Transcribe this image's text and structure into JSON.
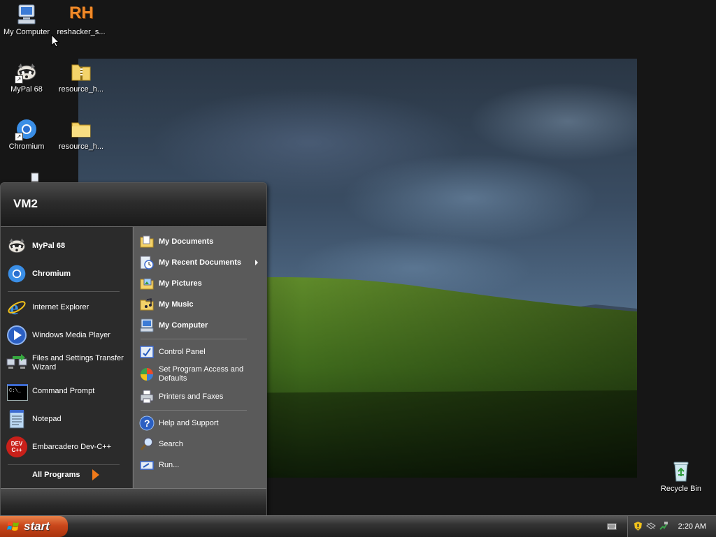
{
  "desktop": {
    "icons": [
      {
        "label": "My Computer"
      },
      {
        "label": "reshacker_s..."
      },
      {
        "label": "MyPal 68"
      },
      {
        "label": "resource_h..."
      },
      {
        "label": "Chromium"
      },
      {
        "label": "resource_h..."
      },
      {
        "label": "Recycle Bin"
      }
    ],
    "reshacker_glyph": "RH"
  },
  "start_menu": {
    "user_name": "VM2",
    "pinned": [
      {
        "label": "MyPal 68"
      },
      {
        "label": "Chromium"
      }
    ],
    "recent": [
      {
        "label": "Internet Explorer"
      },
      {
        "label": "Windows Media Player"
      },
      {
        "label": "Files and Settings Transfer Wizard"
      },
      {
        "label": "Command Prompt"
      },
      {
        "label": "Notepad"
      },
      {
        "label": "Embarcadero Dev-C++"
      }
    ],
    "all_programs_label": "All Programs",
    "places": [
      {
        "label": "My Documents"
      },
      {
        "label": "My Recent Documents"
      },
      {
        "label": "My Pictures"
      },
      {
        "label": "My Music"
      },
      {
        "label": "My Computer"
      }
    ],
    "settings": [
      {
        "label": "Control Panel"
      },
      {
        "label": "Set Program Access and Defaults"
      },
      {
        "label": "Printers and Faxes"
      }
    ],
    "support": [
      {
        "label": "Help and Support"
      },
      {
        "label": "Search"
      },
      {
        "label": "Run..."
      }
    ],
    "cmd_glyph": "C:\\_",
    "devcpp_glyph": "DEV C++"
  },
  "taskbar": {
    "start_label": "start",
    "clock": "2:20 AM"
  },
  "colors": {
    "start_button": "#c9471b",
    "all_programs_arrow": "#f07a1a",
    "menu_left_bg": "#2b2b2b",
    "menu_right_bg": "#5a5a5a"
  }
}
